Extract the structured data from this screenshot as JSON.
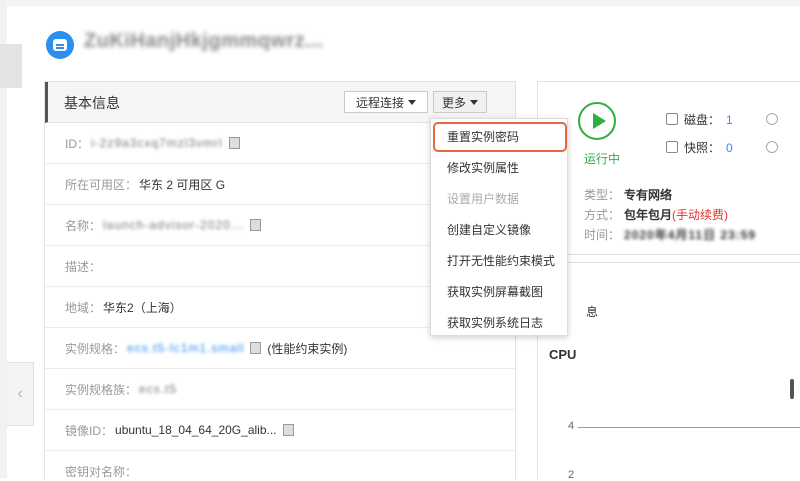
{
  "instance": {
    "name": "ZuKiHanjHkjgmmqwrz..."
  },
  "basic_info": {
    "title": "基本信息",
    "remote_button": "远程连接",
    "more_button": "更多",
    "rows": [
      {
        "label": "ID：",
        "value": "i-2z9a3cxq7mzl3vmrl"
      },
      {
        "label": "所在可用区：",
        "value": "华东 2 可用区 G"
      },
      {
        "label": "名称：",
        "value": "launch-advisor-2020..."
      },
      {
        "label": "描述：",
        "value": ""
      },
      {
        "label": "地域：",
        "value": "华东2（上海）"
      },
      {
        "label": "实例规格：",
        "value": "ecs.t5-lc1m1.small",
        "suffix": "(性能约束实例)"
      },
      {
        "label": "实例规格族：",
        "value": "ecs.t5"
      },
      {
        "label": "镜像ID：",
        "value": "ubuntu_18_04_64_20G_alib..."
      },
      {
        "label": "密钥对名称：",
        "value": ""
      }
    ]
  },
  "more_menu": {
    "items": [
      {
        "label": "重置实例密码",
        "highlighted": true,
        "disabled": false
      },
      {
        "label": "修改实例属性",
        "highlighted": false,
        "disabled": false
      },
      {
        "label": "设置用户数据",
        "highlighted": false,
        "disabled": true
      },
      {
        "label": "创建自定义镜像",
        "highlighted": false,
        "disabled": false
      },
      {
        "label": "打开无性能约束模式",
        "highlighted": false,
        "disabled": false
      },
      {
        "label": "获取实例屏幕截图",
        "highlighted": false,
        "disabled": false
      },
      {
        "label": "获取实例系统日志",
        "highlighted": false,
        "disabled": false
      }
    ]
  },
  "status": {
    "text": "运行中",
    "disk_label": "磁盘：",
    "disk_count": "1",
    "snapshot_label": "快照：",
    "snapshot_count": "0",
    "network_label": "类型：",
    "network_value": "专有网络",
    "billing_label": "方式：",
    "billing_value": "包年包月",
    "billing_note": "(手动续费)",
    "time_label": "时间：",
    "time_value": "2020年4月11日 23:59"
  },
  "monitor": {
    "cut_label": "息",
    "cpu_title": "CPU",
    "axis_value": "4",
    "axis_value_bottom": "2"
  },
  "colors": {
    "running": "#2eae43",
    "link": "#2a8ff0",
    "highlight_border": "#e4673d",
    "warning": "#e0322c"
  }
}
